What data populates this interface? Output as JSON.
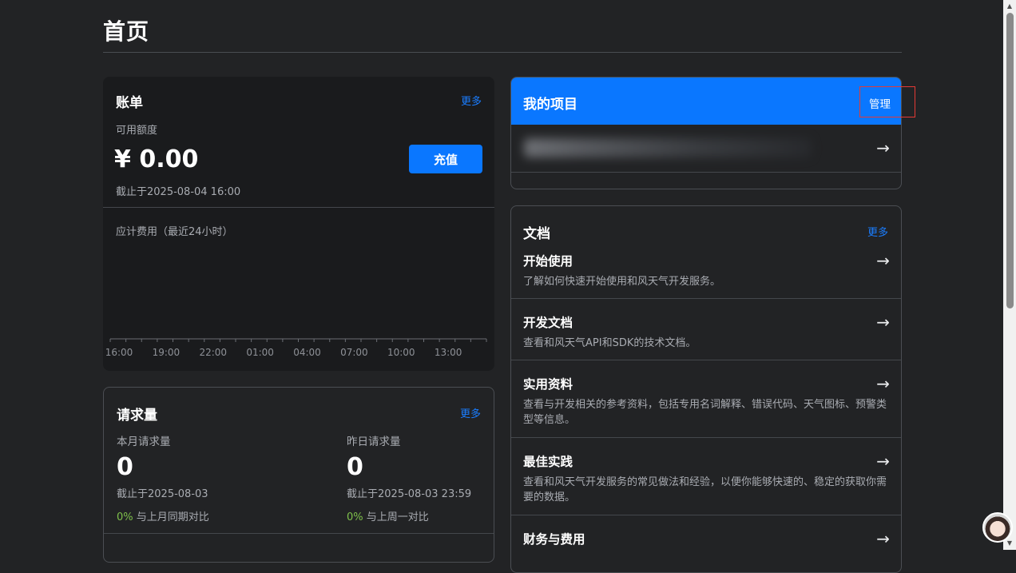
{
  "page": {
    "title": "首页"
  },
  "billing": {
    "title": "账单",
    "more": "更多",
    "available_label": "可用额度",
    "amount": "¥ 0.00",
    "as_of": "截止于2025-08-04 16:00",
    "recharge": "充值",
    "fee_label": "应计费用（最近24小时）",
    "chart_data": {
      "type": "bar",
      "title": "",
      "xlabel": "",
      "ylabel": "",
      "categories": [
        "16:00",
        "19:00",
        "22:00",
        "01:00",
        "04:00",
        "07:00",
        "10:00",
        "13:00"
      ],
      "values": [
        0,
        0,
        0,
        0,
        0,
        0,
        0,
        0
      ],
      "grid": false
    }
  },
  "requests": {
    "title": "请求量",
    "more": "更多",
    "month": {
      "label": "本月请求量",
      "value": "0",
      "as_of": "截止于2025-08-03",
      "pct": "0%",
      "compare": "与上月同期对比"
    },
    "yesterday": {
      "label": "昨日请求量",
      "value": "0",
      "as_of": "截止于2025-08-03 23:59",
      "pct": "0%",
      "compare": "与上周一对比"
    }
  },
  "projects": {
    "title": "我的项目",
    "manage": "管理",
    "arrow": "→"
  },
  "docs": {
    "title": "文档",
    "more": "更多",
    "items": [
      {
        "title": "开始使用",
        "desc": "了解如何快速开始使用和风天气开发服务。"
      },
      {
        "title": "开发文档",
        "desc": "查看和风天气API和SDK的技术文档。"
      },
      {
        "title": "实用资料",
        "desc": "查看与开发相关的参考资料，包括专用名词解释、错误代码、天气图标、预警类型等信息。"
      },
      {
        "title": "最佳实践",
        "desc": "查看和风天气开发服务的常见做法和经验，以便你能够快速的、稳定的获取你需要的数据。"
      },
      {
        "title": "财务与费用",
        "desc": ""
      }
    ],
    "arrow": "→"
  },
  "colors": {
    "accent": "#0a77ff",
    "link": "#1a7dff",
    "positive": "#7fc14b",
    "background": "#222325",
    "card": "#1a1b1d",
    "highlight": "#e53935"
  }
}
